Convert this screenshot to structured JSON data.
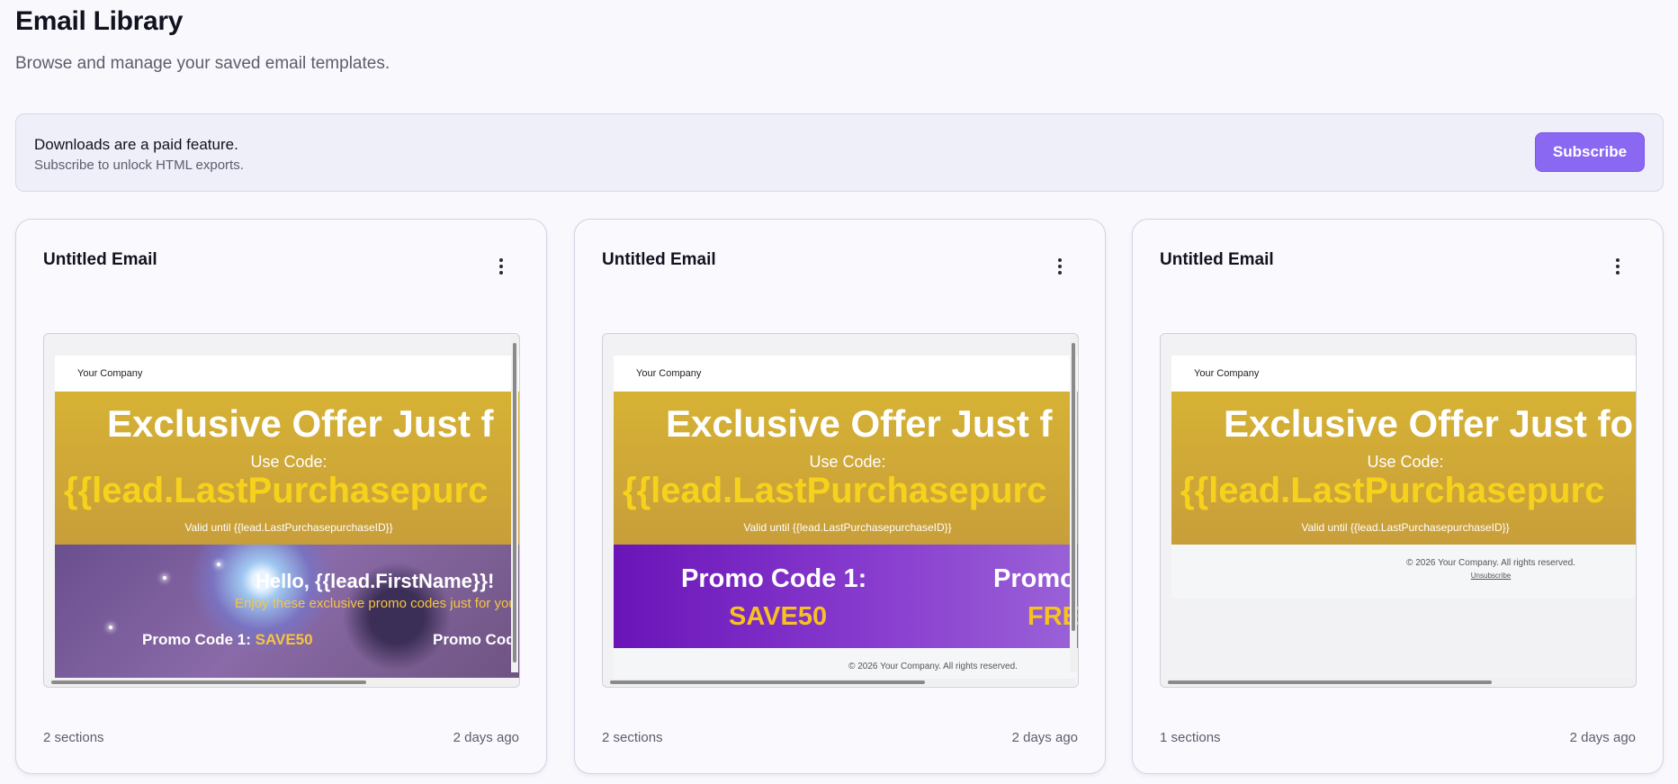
{
  "page": {
    "title": "Email Library",
    "subtitle": "Browse and manage your saved email templates."
  },
  "banner": {
    "title": "Downloads are a paid feature.",
    "subtitle": "Subscribe to unlock HTML exports.",
    "button_label": "Subscribe"
  },
  "colors": {
    "accent": "#8b68f2",
    "offer_gold": "#d6b234",
    "code_yellow": "#f7d21c",
    "promo_purple": "#6a14b8"
  },
  "cards": [
    {
      "title": "Untitled Email",
      "sections": "2 sections",
      "updated": "2 days ago",
      "menu_icon": "more-vertical-icon",
      "preview": {
        "company": "Your Company",
        "offer_title": "Exclusive Offer Just f",
        "code_label": "Use Code:",
        "code_value": "{{lead.LastPurchasepurc",
        "valid": "Valid until {{lead.LastPurchasepurchaseID}}",
        "hello": "Hello, {{lead.FirstName}}!",
        "hello_sub": "Enjoy these exclusive promo codes just for you",
        "promo1_label": "Promo Code 1: ",
        "promo1_code": "SAVE50",
        "promo2_label": "Promo Cod"
      }
    },
    {
      "title": "Untitled Email",
      "sections": "2 sections",
      "updated": "2 days ago",
      "menu_icon": "more-vertical-icon",
      "preview": {
        "company": "Your Company",
        "offer_title": "Exclusive Offer Just f",
        "code_label": "Use Code:",
        "code_value": "{{lead.LastPurchasepurc",
        "valid": "Valid until {{lead.LastPurchasepurchaseID}}",
        "promo1_label": "Promo Code 1:",
        "promo1_code": "SAVE50",
        "promo2_label": "Promo",
        "promo2_code": "FRE",
        "footer_copy": "© 2026 Your Company. All rights reserved."
      }
    },
    {
      "title": "Untitled Email",
      "sections": "1 sections",
      "updated": "2 days ago",
      "menu_icon": "more-vertical-icon",
      "preview": {
        "company": "Your Company",
        "offer_title": "Exclusive Offer Just fo",
        "code_label": "Use Code:",
        "code_value": "{{lead.LastPurchasepurc",
        "valid": "Valid until {{lead.LastPurchasepurchaseID}}",
        "footer_copy": "© 2026 Your Company. All rights reserved.",
        "footer_unsub": "Unsubscribe"
      }
    }
  ]
}
